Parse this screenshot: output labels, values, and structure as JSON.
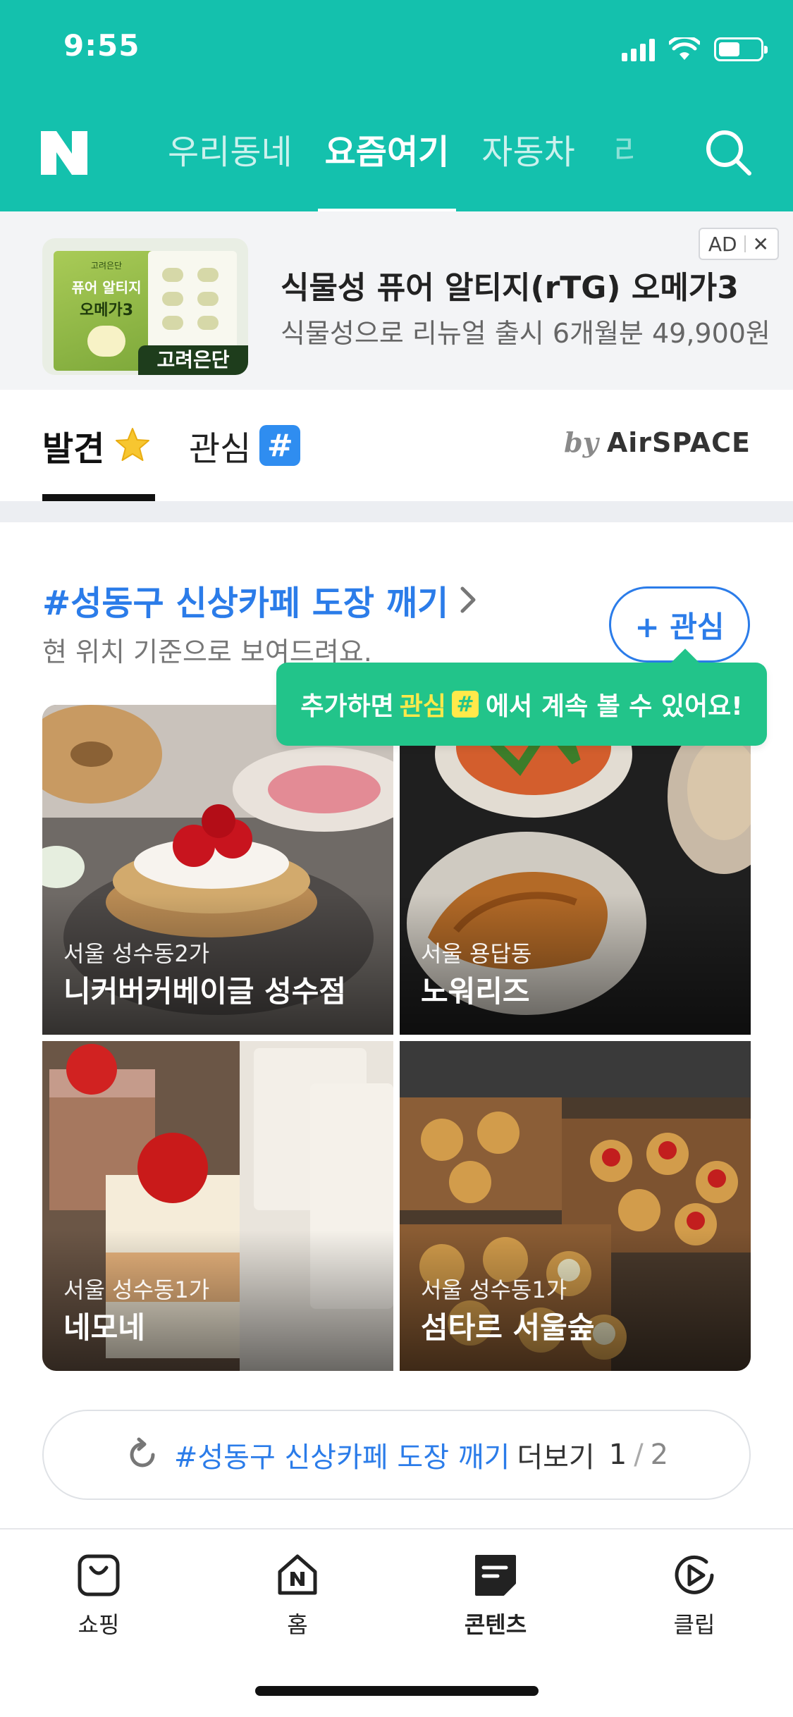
{
  "status_bar": {
    "time": "9:55",
    "battery_level": 0.5
  },
  "header": {
    "logo": "N",
    "tabs": [
      {
        "label": "우리동네",
        "active": false
      },
      {
        "label": "요즘여기",
        "active": true
      },
      {
        "label": "자동차",
        "active": false
      }
    ],
    "more_tab_partial": "리",
    "search_icon": "search-icon",
    "brand_color": "#14c1ad"
  },
  "ad": {
    "title": "식물성 퓨어 알티지(rTG) 오메가3",
    "description": "식물성으로 리뉴얼 출시 6개월분 49,900원",
    "badge": "AD",
    "close": "✕",
    "image_brand_tag": "고려은단",
    "package_title": "퓨어 알티지",
    "package_sub": "오메가3",
    "package_brand": "고려은단"
  },
  "discover_tabs": {
    "tabs": [
      {
        "label": "발견",
        "icon": "star-icon",
        "active": true
      },
      {
        "label": "관심",
        "icon": "hash-icon",
        "active": false
      }
    ],
    "hash_glyph": "#",
    "provider_by": "by",
    "provider_name": "AirSPACE"
  },
  "section": {
    "title": "#성동구 신상카페 도장 깨기",
    "subtitle": "현 위치 기준으로 보여드려요.",
    "follow_label": "+ 관심",
    "tooltip": {
      "prefix": "추가하면",
      "highlight": "관심",
      "hash": "#",
      "suffix": "에서 계속 볼 수 있어요!"
    },
    "places": [
      {
        "location": "서울 성수동2가",
        "name": "니커버커베이글 성수점"
      },
      {
        "location": "서울 용답동",
        "name": "노워리즈"
      },
      {
        "location": "서울 성수동1가",
        "name": "네모네"
      },
      {
        "location": "서울 성수동1가",
        "name": "섬타르 서울숲"
      }
    ]
  },
  "more": {
    "topic": "#성동구 신상카페 도장 깨기",
    "label": "더보기",
    "page": "1",
    "separator": "/",
    "total": "2"
  },
  "bottom_nav": [
    {
      "label": "쇼핑",
      "icon": "shopping-bag-icon",
      "active": false
    },
    {
      "label": "홈",
      "icon": "home-icon",
      "active": false
    },
    {
      "label": "콘텐츠",
      "icon": "contents-icon",
      "active": true
    },
    {
      "label": "클립",
      "icon": "clip-play-icon",
      "active": false
    }
  ],
  "colors": {
    "accent_blue": "#2b7ce9",
    "tooltip_green": "#22c48a"
  }
}
